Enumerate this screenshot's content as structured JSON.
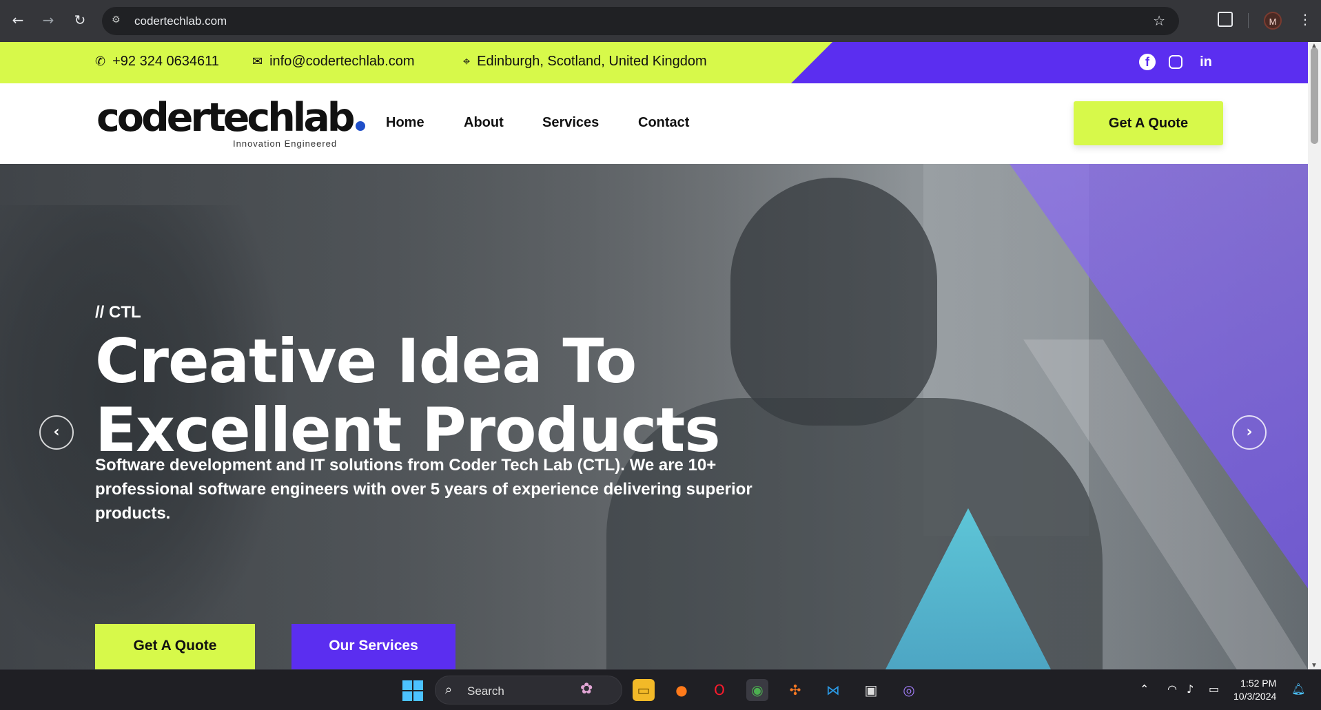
{
  "browser": {
    "url": "codertechlab.com",
    "avatar_letter": "M"
  },
  "topbar": {
    "phone": "+92 324 0634611",
    "email": "info@codertechlab.com",
    "location": "Edinburgh, Scotland, United Kingdom",
    "social": [
      "facebook",
      "instagram",
      "linkedin"
    ]
  },
  "header": {
    "logo_word": "codertechlab",
    "logo_tagline": "Innovation Engineered",
    "menu": [
      "Home",
      "About",
      "Services",
      "Contact"
    ],
    "cta": "Get A Quote"
  },
  "hero": {
    "kicker": "// CTL",
    "title_line1": "Creative Idea To",
    "title_line2": "Excellent Products",
    "description": "Software development and IT solutions from Coder Tech Lab (CTL). We are 10+ professional software engineers with over 5 years of experience delivering superior products.",
    "btn_primary": "Get A Quote",
    "btn_secondary": "Our Services"
  },
  "taskbar": {
    "search_label": "Search",
    "time": "1:52 PM",
    "date": "10/3/2024",
    "chrome_badge": "M"
  },
  "colors": {
    "lime": "#d7f94a",
    "violet": "#5b2ef0"
  }
}
